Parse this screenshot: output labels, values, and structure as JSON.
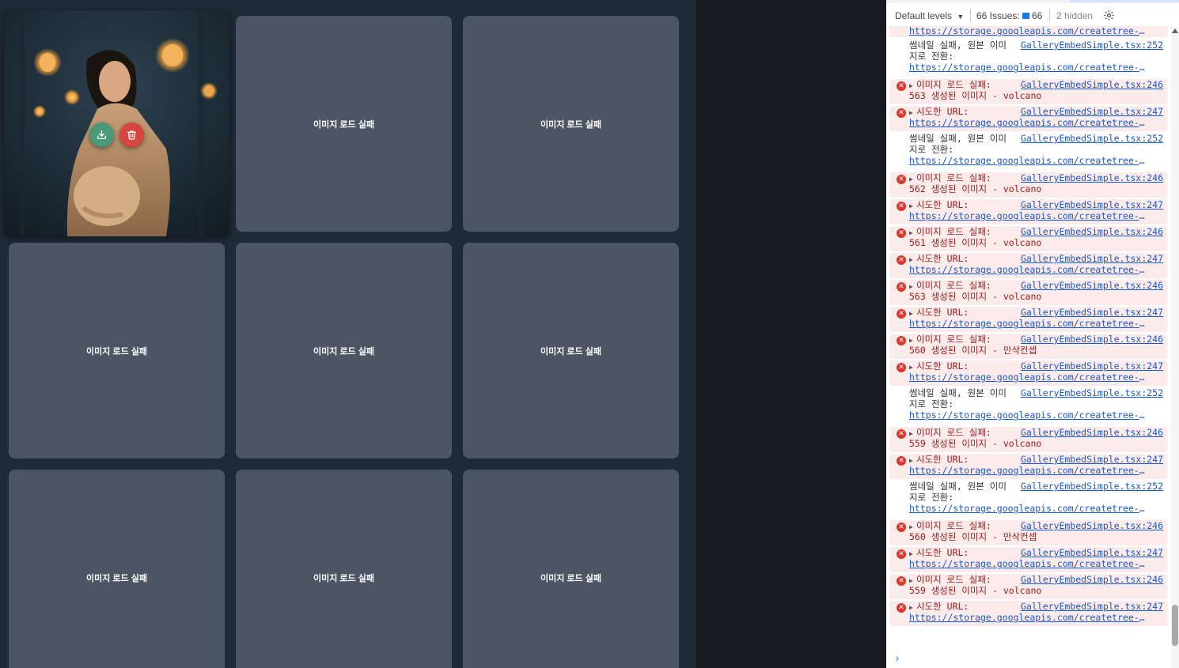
{
  "gallery": {
    "failed_label": "이미지 로드 실패"
  },
  "devtools": {
    "toolbar": {
      "levels_label": "Default levels",
      "issues_label": "66 Issues:",
      "issues_count": "66",
      "hidden_label": "2 hidden"
    },
    "top_partial_url": "https://storage.googleapis.com/createtree-upload…",
    "messages": [
      {
        "type": "log",
        "text": "썸네일 실패, 원본 이미",
        "text2": "지로 전환:",
        "source": "GalleryEmbedSimple.tsx:252",
        "url": "https://storage.googleapis.com/createtree-upload…"
      },
      {
        "type": "error",
        "text": "이미지 로드 실패:",
        "text2": "563 생성된 이미지 - volcano",
        "source": "GalleryEmbedSimple.tsx:246"
      },
      {
        "type": "error",
        "text": "시도한 URL:",
        "source": "GalleryEmbedSimple.tsx:247",
        "url": "https://storage.googleapis.com/createtree-upload…"
      },
      {
        "type": "log",
        "text": "썸네일 실패, 원본 이미",
        "text2": "지로 전환:",
        "source": "GalleryEmbedSimple.tsx:252",
        "url": "https://storage.googleapis.com/createtree-upload…"
      },
      {
        "type": "error",
        "text": "이미지 로드 실패:",
        "text2": "562 생성된 이미지 - volcano",
        "source": "GalleryEmbedSimple.tsx:246"
      },
      {
        "type": "error",
        "text": "시도한 URL:",
        "source": "GalleryEmbedSimple.tsx:247",
        "url": "https://storage.googleapis.com/createtree-upload…"
      },
      {
        "type": "error",
        "text": "이미지 로드 실패:",
        "text2": "561 생성된 이미지 - volcano",
        "source": "GalleryEmbedSimple.tsx:246"
      },
      {
        "type": "error",
        "text": "시도한 URL:",
        "source": "GalleryEmbedSimple.tsx:247",
        "url": "https://storage.googleapis.com/createtree-upload…"
      },
      {
        "type": "error",
        "text": "이미지 로드 실패:",
        "text2": "563 생성된 이미지 - volcano",
        "source": "GalleryEmbedSimple.tsx:246"
      },
      {
        "type": "error",
        "text": "시도한 URL:",
        "source": "GalleryEmbedSimple.tsx:247",
        "url": "https://storage.googleapis.com/createtree-upload…"
      },
      {
        "type": "error",
        "text": "이미지 로드 실패:",
        "text2": "560 생성된 이미지 - 만삭컨셉",
        "source": "GalleryEmbedSimple.tsx:246"
      },
      {
        "type": "error",
        "text": "시도한 URL:",
        "source": "GalleryEmbedSimple.tsx:247",
        "url": "https://storage.googleapis.com/createtree-upload…"
      },
      {
        "type": "log",
        "text": "썸네일 실패, 원본 이미",
        "text2": "지로 전환:",
        "source": "GalleryEmbedSimple.tsx:252",
        "url": "https://storage.googleapis.com/createtree-upload…"
      },
      {
        "type": "error",
        "text": "이미지 로드 실패:",
        "text2": "559 생성된 이미지 - volcano",
        "source": "GalleryEmbedSimple.tsx:246"
      },
      {
        "type": "error",
        "text": "시도한 URL:",
        "source": "GalleryEmbedSimple.tsx:247",
        "url": "https://storage.googleapis.com/createtree-upload…"
      },
      {
        "type": "log",
        "text": "썸네일 실패, 원본 이미",
        "text2": "지로 전환:",
        "source": "GalleryEmbedSimple.tsx:252",
        "url": "https://storage.googleapis.com/createtree-upload…"
      },
      {
        "type": "error",
        "text": "이미지 로드 실패:",
        "text2": "560 생성된 이미지 - 만삭컨셉",
        "source": "GalleryEmbedSimple.tsx:246"
      },
      {
        "type": "error",
        "text": "시도한 URL:",
        "source": "GalleryEmbedSimple.tsx:247",
        "url": "https://storage.googleapis.com/createtree-upload…"
      },
      {
        "type": "error",
        "text": "이미지 로드 실패:",
        "text2": "559 생성된 이미지 - volcano",
        "source": "GalleryEmbedSimple.tsx:246"
      },
      {
        "type": "error",
        "text": "시도한 URL:",
        "source": "GalleryEmbedSimple.tsx:247",
        "url": "https://storage.googleapis.com/createtree-upload…"
      }
    ]
  },
  "colors": {
    "gallery_bg": "#1f2a37",
    "tile_bg": "#4b5563",
    "download_button": "#4a9a77",
    "delete_button": "#d6453f",
    "error_bg": "#fcebeb",
    "error_icon": "#dc362e",
    "link": "#1a57c7"
  },
  "icons": {
    "download": "download-icon",
    "delete": "trash-icon",
    "error": "error-circle-icon",
    "settings": "gear-icon",
    "issues": "message-icon",
    "prompt": "chevron-right-icon"
  }
}
